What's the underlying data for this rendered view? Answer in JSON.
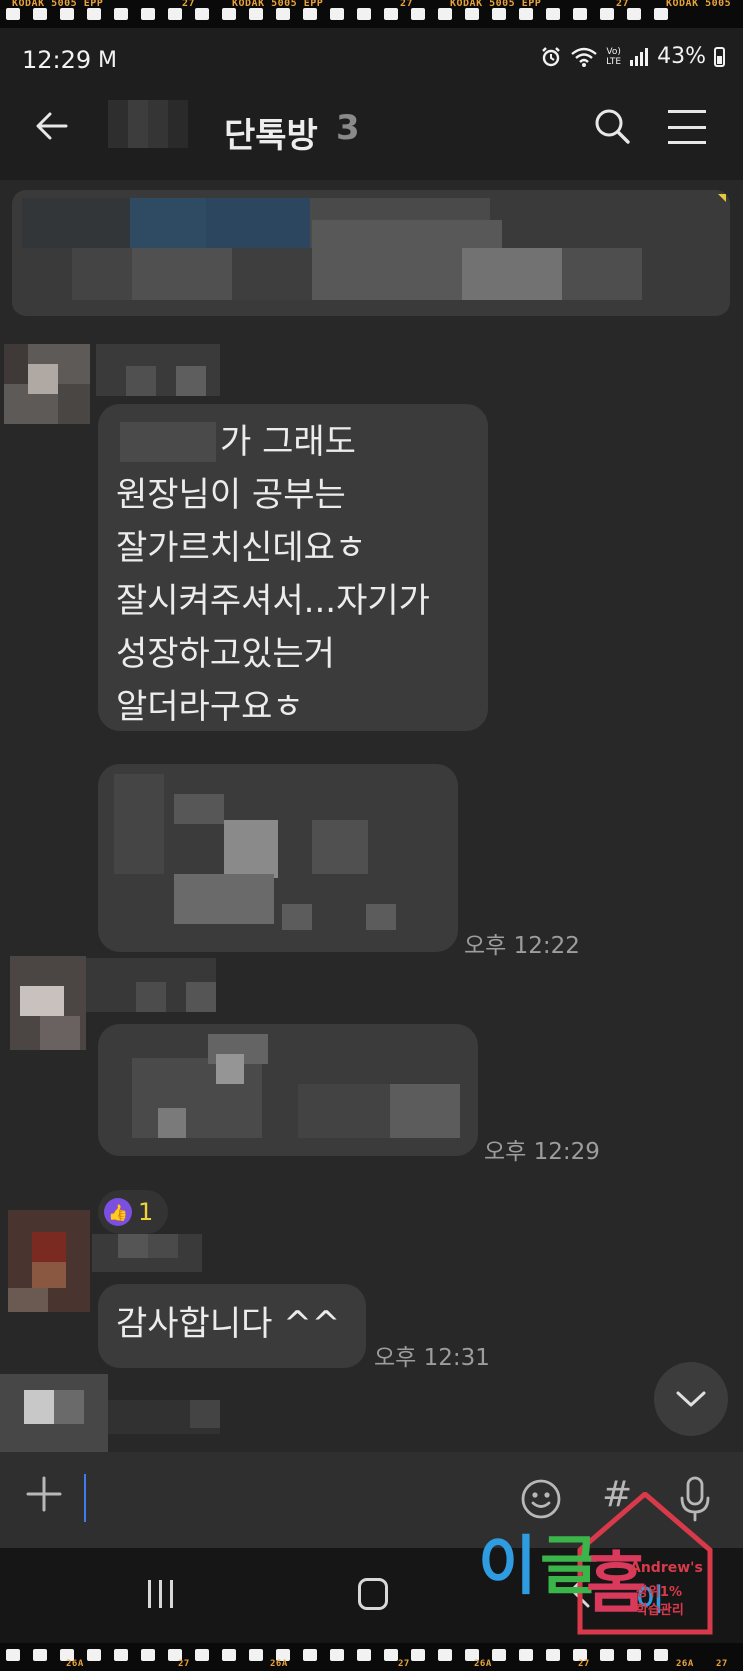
{
  "film": {
    "top_text": [
      "KODAK 5005 EPP",
      "27",
      "KODAK 5005 EPP",
      "27",
      "KODAK 5005 EPP",
      "27",
      "KODAK 5005"
    ],
    "bottom_text": [
      "26A",
      "27",
      "26A",
      "27",
      "26A",
      "27",
      "26A",
      "27"
    ]
  },
  "status": {
    "time": "12:29",
    "mail_icon": "M",
    "volte": "Vo)\nLTE",
    "battery": "43%"
  },
  "header": {
    "title": "단톡방",
    "member_count": "3"
  },
  "messages": [
    {
      "lines": [
        "가 그래도",
        "원장님이 공부는",
        "잘가르치신데요ㅎ",
        "잘시켜주셔서...자기가",
        "성장하고있는거",
        "알더라구요ㅎ"
      ]
    },
    {
      "time": "오후 12:22"
    },
    {
      "time": "오후 12:29",
      "reaction_count": "1"
    },
    {
      "text": "감사합니다 ^^",
      "time": "오후 12:31"
    }
  ],
  "watermark": {
    "brand": "Andrew's",
    "text": "이글홈",
    "tagline": "상위1% 학습관리",
    "sub": "이"
  },
  "colors": {
    "background": "#282829",
    "bubble": "#3b3b3c",
    "accent_caret": "#3d7bf2",
    "reaction": "#7b4fe0"
  }
}
